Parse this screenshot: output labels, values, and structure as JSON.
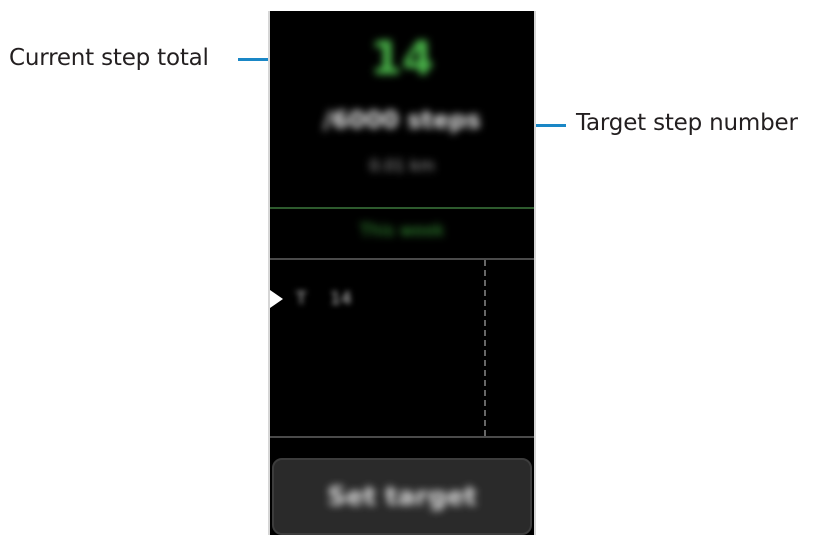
{
  "callouts": {
    "current_step_total": "Current step total",
    "target_step_number": "Target step number"
  },
  "screen": {
    "step_count": "14",
    "target_steps": "/6000 steps",
    "distance": "0.01 km",
    "period_label": "This week",
    "graph": {
      "day": "T",
      "value": "14"
    },
    "set_target_button": "Set target"
  },
  "colors": {
    "accent_green": "#4ab54a",
    "callout_blue": "#1a87c6",
    "screen_background": "#000000"
  }
}
